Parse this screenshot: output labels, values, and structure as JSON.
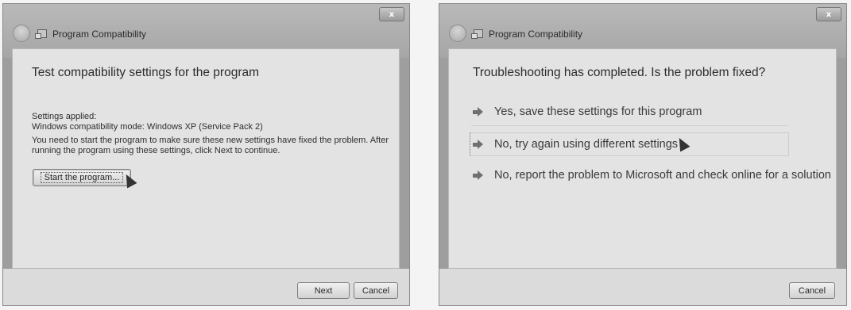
{
  "left_window": {
    "title": "Program Compatibility",
    "close_label": "x",
    "heading": "Test compatibility settings for the program",
    "settings_applied_label": "Settings applied:",
    "settings_applied_value": "Windows compatibility mode: Windows XP (Service Pack 2)",
    "instructions_line1": "You need to start the program to make sure these new settings have fixed the problem. After",
    "instructions_line2": "running the program using these settings, click Next to continue.",
    "start_button": "Start the program...",
    "next_button": "Next",
    "cancel_button": "Cancel"
  },
  "right_window": {
    "title": "Program Compatibility",
    "close_label": "x",
    "heading": "Troubleshooting has completed.  Is the problem fixed?",
    "options": [
      "Yes, save these settings for this program",
      "No, try again using different settings",
      "No, report the problem to Microsoft and check online for a solution"
    ],
    "cancel_button": "Cancel"
  },
  "icons": {
    "back": "back-arrow-icon",
    "app": "program-window-icon",
    "option_arrow": "green-arrow-icon",
    "cursor": "mouse-pointer-icon"
  }
}
